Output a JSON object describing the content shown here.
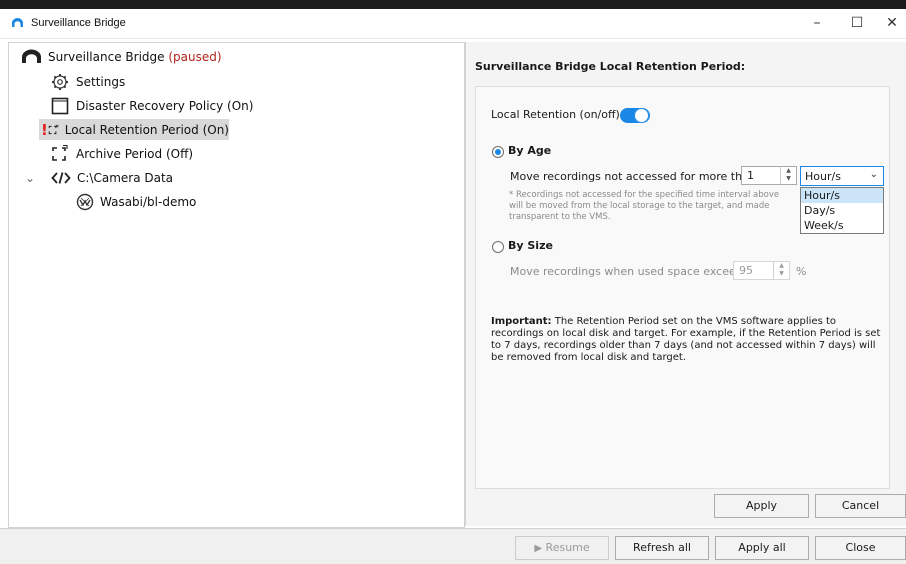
{
  "window": {
    "title": "Surveillance Bridge",
    "minimize_glyph": "–",
    "maximize_glyph": "☐",
    "close_glyph": "✕"
  },
  "tree": {
    "root": {
      "label": "Surveillance Bridge",
      "status": "(paused)",
      "icon": "cloud-icon"
    },
    "items": [
      {
        "label": "Settings",
        "icon": "gear-icon"
      },
      {
        "label": "Disaster Recovery Policy (On)",
        "icon": "disaster-recovery-icon"
      },
      {
        "label": "Local Retention Period (On)",
        "icon": "local-retention-icon",
        "selected": true,
        "warning": "!"
      },
      {
        "label": "Archive Period (Off)",
        "icon": "archive-period-icon"
      },
      {
        "label": "C:\\Camera Data",
        "icon": "code-brackets-icon",
        "expand_glyph": "⌄"
      },
      {
        "label": "Wasabi/bl-demo",
        "icon": "wasabi-icon"
      }
    ]
  },
  "panel": {
    "title": "Surveillance Bridge Local Retention Period:",
    "toggle_label": "Local Retention (on/off)",
    "toggle_on": true,
    "by_age": {
      "label": "By Age",
      "selected": true,
      "move_label": "Move recordings not accessed for more than",
      "value": "1",
      "unit_selected": "Hour/s",
      "unit_options": [
        "Hour/s",
        "Day/s",
        "Week/s"
      ],
      "note": "* Recordings not accessed for the specified time interval above will be moved from the local storage to the target, and made transparent to the VMS."
    },
    "by_size": {
      "label": "By Size",
      "selected": false,
      "move_label": "Move recordings when used space exceeds",
      "value": "95",
      "unit": "%"
    },
    "important_label": "Important:",
    "important_text": " The Retention Period set on the VMS software applies to recordings on local disk and target. For example, if the Retention Period is set to 7 days, recordings older than 7 days (and not accessed within 7 days) will be removed from local disk and target.",
    "apply_label": "Apply",
    "cancel_label": "Cancel"
  },
  "bottom": {
    "resume_label": "Resume",
    "refresh_label": "Refresh all",
    "apply_all_label": "Apply all",
    "close_label": "Close"
  },
  "colors": {
    "accent": "#1a87e6",
    "paused": "#b3241c",
    "warning": "#e0201b",
    "selection": "#d9d9d9"
  }
}
